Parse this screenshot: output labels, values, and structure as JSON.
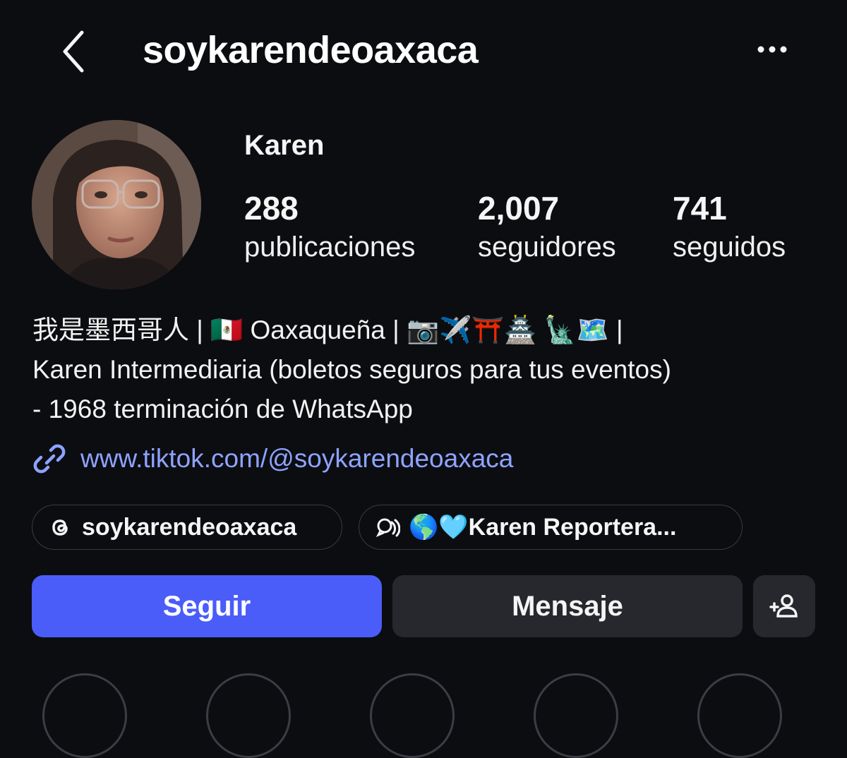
{
  "header": {
    "username": "soykarendeoaxaca"
  },
  "profile": {
    "display_name": "Karen",
    "stats": [
      {
        "value": "288",
        "label": "publicaciones"
      },
      {
        "value": "2,007",
        "label": "seguidores"
      },
      {
        "value": "741",
        "label": "seguidos"
      }
    ],
    "bio_lines": [
      "我是墨西哥人 | 🇲🇽 Oaxaqueña | 📷✈️⛩️🏯 🗽🗺️ |",
      "Karen Intermediaria (boletos seguros para tus eventos)",
      "- 1968 terminación de WhatsApp"
    ],
    "link": "www.tiktok.com/@soykarendeoaxaca"
  },
  "chips": {
    "threads_handle": "soykarendeoaxaca",
    "channel_name": "🌎🩵Karen Reportera..."
  },
  "actions": {
    "follow_label": "Seguir",
    "message_label": "Mensaje"
  },
  "colors": {
    "background": "#0c0d11",
    "accent": "#4a5df9",
    "link": "#8ea3ff",
    "secondary_button": "#27282e"
  },
  "icons": {
    "back": "chevron-left-icon",
    "more": "more-horizontal-icon",
    "link": "link-icon",
    "threads": "threads-icon",
    "channel": "broadcast-chat-icon",
    "add_user": "add-user-icon"
  }
}
